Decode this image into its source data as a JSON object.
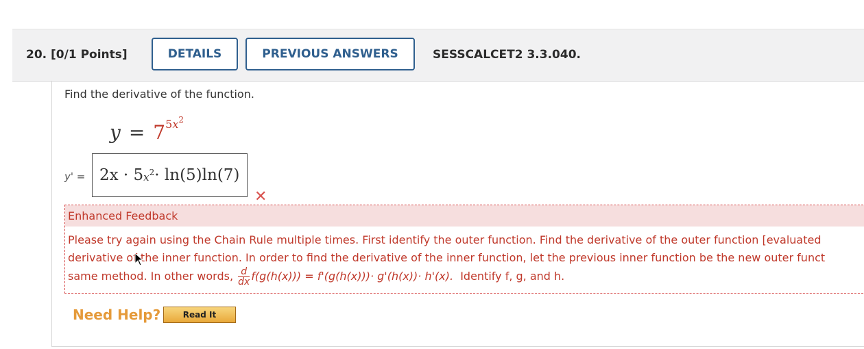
{
  "header": {
    "question_label": "20.  [0/1 Points]",
    "details_button": "DETAILS",
    "previous_answers_button": "PREVIOUS ANSWERS",
    "question_code": "SESSCALCET2 3.3.040."
  },
  "question": {
    "prompt": "Find the derivative of the function.",
    "function_lhs": "y",
    "function_equals": "=",
    "function_base": "7",
    "function_exp_base": "5",
    "function_exp_var": "x",
    "function_exp_power": "2"
  },
  "answer": {
    "label": "y' =",
    "prefix": "2x · 5",
    "exp": "x",
    "exp_power": "2",
    "suffix": " · ln(5)ln(7)",
    "status_icon": "wrong-x-icon",
    "status_color": "#d9534f"
  },
  "feedback": {
    "title": "Enhanced Feedback",
    "line1": "Please try again using the Chain Rule multiple times. First identify the outer function. Find the derivative of the outer function [evaluated",
    "line2": "derivative of the inner function. In order to find the derivative of the inner function, let the previous inner function be the new outer funct",
    "line3_prefix": "same method. In other words,",
    "frac_num": "d",
    "frac_den": "dx",
    "line3_formula": "f(g(h(x))) = f'(g(h(x)))· g'(h(x))· h'(x).",
    "line3_suffix": "Identify f, g, and h.",
    "color": "#c0392b"
  },
  "help": {
    "label": "Need Help?",
    "read_it_button": "Read It"
  },
  "colors": {
    "accent": "#2f5f8e",
    "help_orange": "#e59a3a"
  }
}
